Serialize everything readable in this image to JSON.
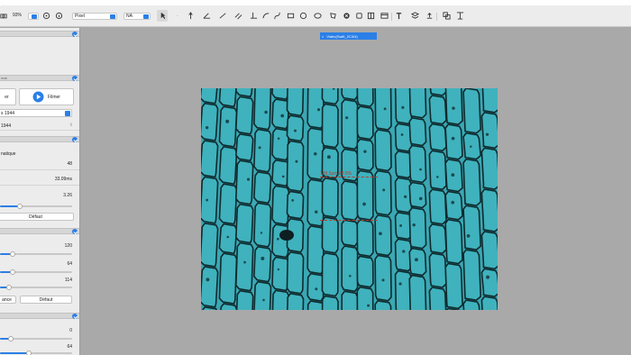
{
  "toolbar": {
    "zoom": "93%",
    "unit_select": "Pixel",
    "na_select": "NA",
    "tools": [
      "pointer-tool",
      "arrow-tool",
      "angle-tool",
      "line-tool",
      "parallel-tool",
      "perpendicular-tool",
      "arc-tool",
      "curve-tool",
      "rect-tool",
      "circle-tool",
      "ellipse-tool",
      "polygon-tool",
      "delete-tool",
      "square-tool",
      "grid-tool",
      "table-tool",
      "text-tool",
      "layers-tool",
      "duplicate-tool",
      "align-tool"
    ]
  },
  "document_tab": {
    "label": "Vidéo(Swift_2C3/4)",
    "close": "×"
  },
  "sidebar": {
    "section1": {
      "label": "mat"
    },
    "capture": {
      "shoot_label": "er",
      "film_label": "Filmer"
    },
    "resolution_select": "s 1944",
    "resolution2": "1944",
    "section2": {
      "label": ""
    },
    "auto_label": "natique",
    "rows": [
      {
        "label": "",
        "value": "48"
      },
      {
        "label": "",
        "value": "33.09ms"
      },
      {
        "label": "",
        "value": "3.26"
      }
    ],
    "defaut_button": "Défaut",
    "section3": {
      "label": ""
    },
    "rows2": [
      {
        "label": "",
        "value": "120"
      },
      {
        "label": "",
        "value": "64"
      },
      {
        "label": "",
        "value": "114"
      }
    ],
    "balance_button": "ance",
    "defaut_button2": "Défaut",
    "section4": {
      "label": ""
    },
    "rows3": [
      {
        "label": "",
        "value": "0"
      },
      {
        "label": "",
        "value": "64"
      }
    ],
    "slider_levels": [
      0.27,
      0.18,
      0.18,
      0.13,
      0.15,
      0.4
    ]
  },
  "overlay": {
    "scale_label": "189.5μm 88.5%"
  },
  "colors": {
    "accent": "#2b7fe6",
    "image_bg": "#3aa8b4",
    "measure": "#c0392b"
  }
}
